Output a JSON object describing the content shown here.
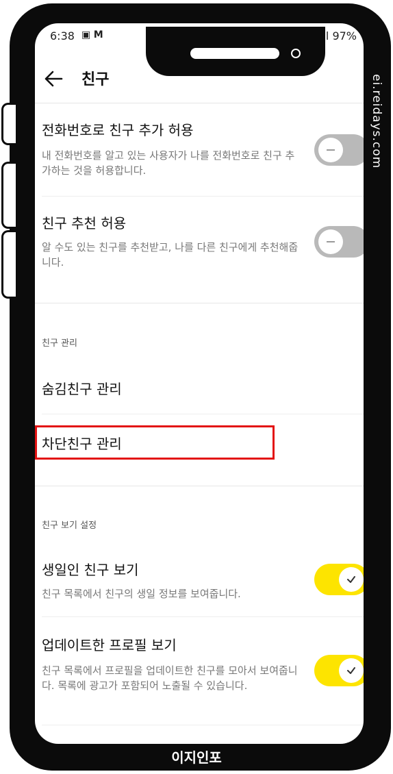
{
  "status_bar": {
    "time": "6:38",
    "left_icons": [
      "gallery-icon",
      "gmail-icon"
    ],
    "right_text": "HD ⁺ıl 97%"
  },
  "header": {
    "title": "친구"
  },
  "settings": {
    "phone_add": {
      "title": "전화번호로 친구 추가 허용",
      "desc": "내 전화번호를 알고 있는 사용자가 나를 전화번호로 친구 추가하는 것을 허용합니다.",
      "enabled": false
    },
    "recommend": {
      "title": "친구 추천 허용",
      "desc": "알 수도 있는 친구를 추천받고, 나를 다른 친구에게 추천해줍니다.",
      "enabled": false
    }
  },
  "manage_section": {
    "header": "친구 관리",
    "hidden": "숨김친구 관리",
    "blocked": "차단친구 관리"
  },
  "view_section": {
    "header": "친구 보기 설정",
    "birthday": {
      "title": "생일인 친구 보기",
      "desc": "친구 목록에서 친구의 생일 정보를 보여줍니다.",
      "enabled": true
    },
    "updated_profile": {
      "title": "업데이트한 프로필 보기",
      "desc": "친구 목록에서 프로필을 업데이트한 친구를 모아서 보여줍니다. 목록에 광고가 포함되어 노출될 수 있습니다.",
      "enabled": true
    }
  },
  "colors": {
    "toggle_on": "#fde400",
    "toggle_off": "#b9b9b9",
    "highlight": "#e31212"
  },
  "watermark": "ei.reidays.com",
  "brand": "이지인포"
}
